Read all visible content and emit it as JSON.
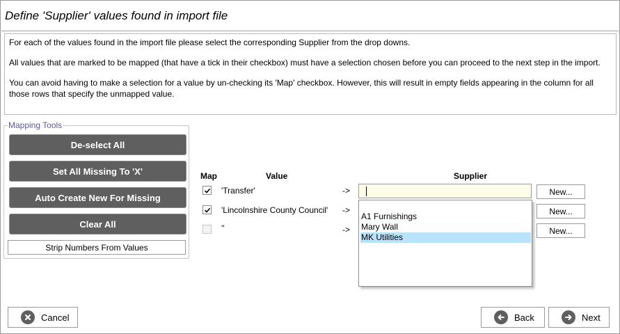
{
  "window": {
    "title": "Define 'Supplier' values found in import file"
  },
  "info": {
    "p1": "For each of the values found in the import file please select the corresponding Supplier from the drop downs.",
    "p2": "All values that are marked to be mapped (that have a tick in their checkbox) must have a selection chosen before you can proceed to the next step in the import.",
    "p3": "You can avoid having to make a selection for a value by un-checking its 'Map' checkbox. However, this will result in empty fields appearing in the column for all those rows that specify the unmapped value."
  },
  "mapping_tools": {
    "legend": "Mapping Tools",
    "deselect_all": "De-select All",
    "set_all_missing": "Set All Missing To 'X'",
    "auto_create": "Auto Create New For Missing",
    "clear_all": "Clear All",
    "strip_numbers": "Strip Numbers From Values"
  },
  "grid": {
    "headers": {
      "map": "Map",
      "value": "Value",
      "supplier": "Supplier"
    },
    "rows": [
      {
        "checked": true,
        "value": "'Transfer'",
        "arrow": "->",
        "new_label": "New..."
      },
      {
        "checked": true,
        "value": "'Lincolnshire County Council'",
        "arrow": "->",
        "new_label": "New..."
      },
      {
        "checked": false,
        "value": "''",
        "arrow": "->",
        "new_label": "New..."
      }
    ],
    "supplier_input_value": ""
  },
  "dropdown": {
    "options": [
      "A1 Furnishings",
      "Mary Wall",
      "MK Utilities"
    ],
    "highlighted": "MK Utilities"
  },
  "footer": {
    "cancel": "Cancel",
    "back": "Back",
    "next": "Next"
  },
  "colors": {
    "tool_button_bg": "#5f5f5f",
    "input_bg": "#fffde9",
    "highlight": "#b9e3fa",
    "legend_text": "#5a5aa0"
  }
}
